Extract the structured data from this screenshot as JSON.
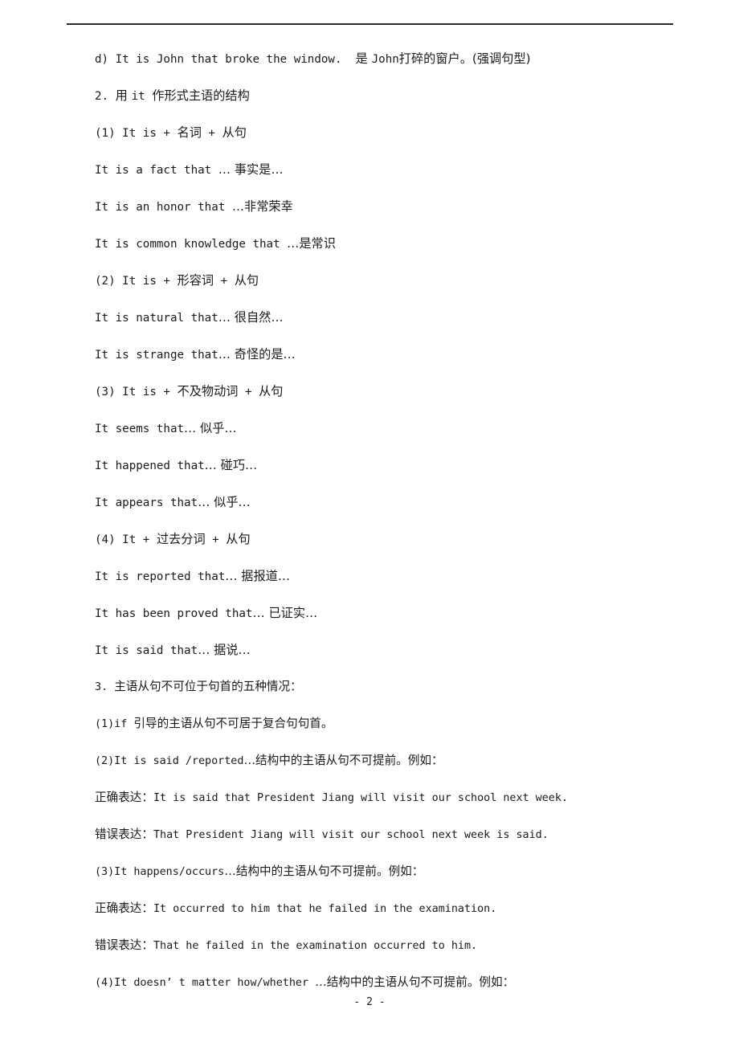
{
  "document": {
    "page_number_label": "- 2 -",
    "has_header_rule": true,
    "text_color": "#1a1a1a",
    "rule_color": "#2b2b2b"
  },
  "lines": [
    {
      "id": "line-d",
      "kind": "example",
      "segments": [
        {
          "script": "en",
          "text": "d) It is John that broke the window.  "
        },
        {
          "script": "cn",
          "text": "是 "
        },
        {
          "script": "en",
          "text": "John"
        },
        {
          "script": "cn",
          "text": "打碎的窗户。(强调句型)"
        }
      ]
    },
    {
      "id": "line-heading-2",
      "kind": "heading",
      "segments": [
        {
          "script": "en",
          "text": "2. "
        },
        {
          "script": "cn",
          "text": "用 "
        },
        {
          "script": "en",
          "text": "it "
        },
        {
          "script": "cn",
          "text": "作形式主语的结构"
        }
      ]
    },
    {
      "id": "line-2-1",
      "kind": "subheading",
      "segments": [
        {
          "script": "en",
          "text": "(1) It is + "
        },
        {
          "script": "cn",
          "text": "名词"
        },
        {
          "script": "en",
          "text": " + "
        },
        {
          "script": "cn",
          "text": "从句"
        }
      ]
    },
    {
      "id": "line-fact",
      "kind": "example",
      "segments": [
        {
          "script": "en",
          "text": "It is a fact that "
        },
        {
          "script": "cn",
          "text": "… 事实是…"
        }
      ]
    },
    {
      "id": "line-honor",
      "kind": "example",
      "segments": [
        {
          "script": "en",
          "text": "It is an honor that "
        },
        {
          "script": "cn",
          "text": "…非常荣幸"
        }
      ]
    },
    {
      "id": "line-common-knowledge",
      "kind": "example",
      "segments": [
        {
          "script": "en",
          "text": "It is common knowledge that "
        },
        {
          "script": "cn",
          "text": "…是常识"
        }
      ]
    },
    {
      "id": "line-2-2",
      "kind": "subheading",
      "segments": [
        {
          "script": "en",
          "text": "(2) It is + "
        },
        {
          "script": "cn",
          "text": "形容词"
        },
        {
          "script": "en",
          "text": " + "
        },
        {
          "script": "cn",
          "text": "从句"
        }
      ]
    },
    {
      "id": "line-natural",
      "kind": "example",
      "segments": [
        {
          "script": "en",
          "text": "It is natural that"
        },
        {
          "script": "cn",
          "text": "… 很自然…"
        }
      ]
    },
    {
      "id": "line-strange",
      "kind": "example",
      "segments": [
        {
          "script": "en",
          "text": "It is strange that"
        },
        {
          "script": "cn",
          "text": "… 奇怪的是…"
        }
      ]
    },
    {
      "id": "line-2-3",
      "kind": "subheading",
      "segments": [
        {
          "script": "en",
          "text": "(3) It is + "
        },
        {
          "script": "cn",
          "text": "不及物动词"
        },
        {
          "script": "en",
          "text": " + "
        },
        {
          "script": "cn",
          "text": "从句"
        }
      ]
    },
    {
      "id": "line-seems",
      "kind": "example",
      "segments": [
        {
          "script": "en",
          "text": "It seems that"
        },
        {
          "script": "cn",
          "text": "… 似乎…"
        }
      ]
    },
    {
      "id": "line-happened",
      "kind": "example",
      "segments": [
        {
          "script": "en",
          "text": "It happened that"
        },
        {
          "script": "cn",
          "text": "… 碰巧…"
        }
      ]
    },
    {
      "id": "line-appears",
      "kind": "example",
      "segments": [
        {
          "script": "en",
          "text": "It appears that"
        },
        {
          "script": "cn",
          "text": "… 似乎…"
        }
      ]
    },
    {
      "id": "line-2-4",
      "kind": "subheading",
      "segments": [
        {
          "script": "en",
          "text": "(4) It + "
        },
        {
          "script": "cn",
          "text": "过去分词"
        },
        {
          "script": "en",
          "text": " + "
        },
        {
          "script": "cn",
          "text": "从句"
        }
      ]
    },
    {
      "id": "line-reported",
      "kind": "example",
      "segments": [
        {
          "script": "en",
          "text": "It is reported that"
        },
        {
          "script": "cn",
          "text": "… 据报道…"
        }
      ]
    },
    {
      "id": "line-proved",
      "kind": "example",
      "segments": [
        {
          "script": "en",
          "text": "It has been proved that"
        },
        {
          "script": "cn",
          "text": "… 已证实…"
        }
      ]
    },
    {
      "id": "line-said",
      "kind": "example",
      "segments": [
        {
          "script": "en",
          "text": "It is said that"
        },
        {
          "script": "cn",
          "text": "… 据说…"
        }
      ]
    },
    {
      "id": "line-heading-3",
      "kind": "heading",
      "section": "3",
      "segments": [
        {
          "script": "en",
          "text": "3. "
        },
        {
          "script": "cn",
          "text": "主语从句不可位于句首的五种情况："
        }
      ]
    },
    {
      "id": "line-3-1",
      "kind": "rule",
      "section": "3",
      "segments": [
        {
          "script": "en",
          "text": "(1)if "
        },
        {
          "script": "cn",
          "text": "引导的主语从句不可居于复合句句首。"
        }
      ]
    },
    {
      "id": "line-3-2",
      "kind": "rule",
      "section": "3",
      "segments": [
        {
          "script": "en",
          "text": "(2)It is said /reported"
        },
        {
          "script": "cn",
          "text": "…结构中的主语从句不可提前。例如："
        }
      ]
    },
    {
      "id": "line-3-2-correct",
      "kind": "correct-example",
      "section": "3",
      "segments": [
        {
          "script": "cn",
          "text": "正确表达："
        },
        {
          "script": "en",
          "text": "It is said that President Jiang will visit our school next week."
        }
      ]
    },
    {
      "id": "line-3-2-wrong",
      "kind": "wrong-example",
      "section": "3",
      "segments": [
        {
          "script": "cn",
          "text": "错误表达："
        },
        {
          "script": "en",
          "text": "That President Jiang will visit our school next week is said."
        }
      ]
    },
    {
      "id": "line-3-3",
      "kind": "rule",
      "section": "3",
      "segments": [
        {
          "script": "en",
          "text": "(3)It happens/occurs"
        },
        {
          "script": "cn",
          "text": "…结构中的主语从句不可提前。例如："
        }
      ]
    },
    {
      "id": "line-3-3-correct",
      "kind": "correct-example",
      "section": "3",
      "segments": [
        {
          "script": "cn",
          "text": "正确表达："
        },
        {
          "script": "en",
          "text": "It occurred to him that he failed in the examination."
        }
      ]
    },
    {
      "id": "line-3-3-wrong",
      "kind": "wrong-example",
      "section": "3",
      "segments": [
        {
          "script": "cn",
          "text": "错误表达："
        },
        {
          "script": "en",
          "text": "That he failed in the examination occurred to him."
        }
      ]
    },
    {
      "id": "line-3-4",
      "kind": "rule",
      "section": "3",
      "segments": [
        {
          "script": "en",
          "text": "(4)It doesn’ t matter how/whether "
        },
        {
          "script": "cn",
          "text": "…结构中的主语从句不可提前。例如："
        }
      ]
    }
  ]
}
